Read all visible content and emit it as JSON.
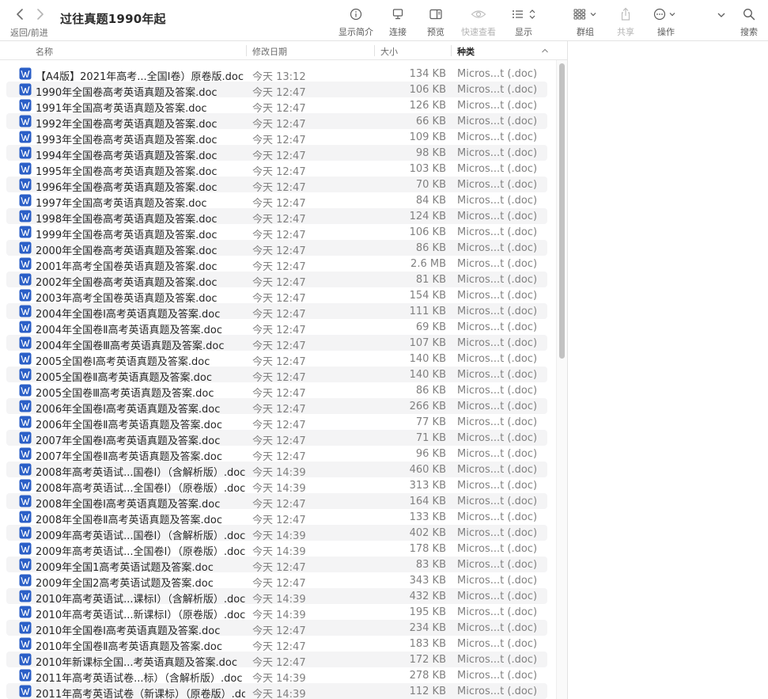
{
  "window": {
    "title": "过往真题1990年起",
    "nav_label": "返回/前进"
  },
  "toolbar": {
    "buttons": [
      {
        "label": "显示简介",
        "icon": "info-icon",
        "enabled": true
      },
      {
        "label": "连接",
        "icon": "monitor-icon",
        "enabled": true
      },
      {
        "label": "预览",
        "icon": "preview-pane-icon",
        "enabled": true
      },
      {
        "label": "快速查看",
        "icon": "eye-icon",
        "enabled": false
      },
      {
        "label": "显示",
        "icon": "list-view-icon",
        "enabled": true
      },
      {
        "label": "群组",
        "icon": "group-grid-icon",
        "enabled": true
      },
      {
        "label": "共享",
        "icon": "share-icon",
        "enabled": false
      },
      {
        "label": "操作",
        "icon": "ellipsis-circle-icon",
        "enabled": true
      },
      {
        "label": "搜索",
        "icon": "search-icon",
        "enabled": true
      }
    ]
  },
  "columns": {
    "name": "名称",
    "date": "修改日期",
    "size": "大小",
    "kind": "种类"
  },
  "files": [
    {
      "name": "【A4版】2021年高考...全国Ⅰ卷）原卷版.doc",
      "date": "今天 13:12",
      "size": "134 KB",
      "kind": "Micros...t (.doc)"
    },
    {
      "name": "1990年全国卷高考英语真题及答案.doc",
      "date": "今天 12:47",
      "size": "106 KB",
      "kind": "Micros...t (.doc)"
    },
    {
      "name": "1991年全国高考英语真题及答案.doc",
      "date": "今天 12:47",
      "size": "126 KB",
      "kind": "Micros...t (.doc)"
    },
    {
      "name": "1992年全国卷高考英语真题及答案.doc",
      "date": "今天 12:47",
      "size": "66 KB",
      "kind": "Micros...t (.doc)"
    },
    {
      "name": "1993年全国卷高考英语真题及答案.doc",
      "date": "今天 12:47",
      "size": "109 KB",
      "kind": "Micros...t (.doc)"
    },
    {
      "name": "1994年全国卷高考英语真题及答案.doc",
      "date": "今天 12:47",
      "size": "98 KB",
      "kind": "Micros...t (.doc)"
    },
    {
      "name": "1995年全国卷高考英语真题及答案.doc",
      "date": "今天 12:47",
      "size": "103 KB",
      "kind": "Micros...t (.doc)"
    },
    {
      "name": "1996年全国卷高考英语真题及答案.doc",
      "date": "今天 12:47",
      "size": "70 KB",
      "kind": "Micros...t (.doc)"
    },
    {
      "name": "1997年全国高考英语真题及答案.doc",
      "date": "今天 12:47",
      "size": "84 KB",
      "kind": "Micros...t (.doc)"
    },
    {
      "name": "1998年全国卷高考英语真题及答案.doc",
      "date": "今天 12:47",
      "size": "124 KB",
      "kind": "Micros...t (.doc)"
    },
    {
      "name": "1999年全国卷高考英语真题及答案.doc",
      "date": "今天 12:47",
      "size": "106 KB",
      "kind": "Micros...t (.doc)"
    },
    {
      "name": "2000年全国卷高考英语真题及答案.doc",
      "date": "今天 12:47",
      "size": "86 KB",
      "kind": "Micros...t (.doc)"
    },
    {
      "name": "2001年高考全国卷英语真题及答案.doc",
      "date": "今天 12:47",
      "size": "2.6 MB",
      "kind": "Micros...t (.doc)"
    },
    {
      "name": "2002年全国卷高考英语真题及答案.doc",
      "date": "今天 12:47",
      "size": "81 KB",
      "kind": "Micros...t (.doc)"
    },
    {
      "name": "2003年高考全国卷英语真题及答案.doc",
      "date": "今天 12:47",
      "size": "154 KB",
      "kind": "Micros...t (.doc)"
    },
    {
      "name": "2004年全国卷Ⅰ高考英语真题及答案.doc",
      "date": "今天 12:47",
      "size": "111 KB",
      "kind": "Micros...t (.doc)"
    },
    {
      "name": "2004年全国卷Ⅱ高考英语真题及答案.doc",
      "date": "今天 12:47",
      "size": "69 KB",
      "kind": "Micros...t (.doc)"
    },
    {
      "name": "2004年全国卷Ⅲ高考英语真题及答案.doc",
      "date": "今天 12:47",
      "size": "107 KB",
      "kind": "Micros...t (.doc)"
    },
    {
      "name": "2005全国卷Ⅰ高考英语真题及答案.doc",
      "date": "今天 12:47",
      "size": "140 KB",
      "kind": "Micros...t (.doc)"
    },
    {
      "name": "2005全国卷Ⅱ高考英语真题及答案.doc",
      "date": "今天 12:47",
      "size": "140 KB",
      "kind": "Micros...t (.doc)"
    },
    {
      "name": "2005全国卷Ⅲ高考英语真题及答案.doc",
      "date": "今天 12:47",
      "size": "86 KB",
      "kind": "Micros...t (.doc)"
    },
    {
      "name": "2006年全国卷Ⅰ高考英语真题及答案.doc",
      "date": "今天 12:47",
      "size": "266 KB",
      "kind": "Micros...t (.doc)"
    },
    {
      "name": "2006年全国卷Ⅱ高考英语真题及答案.doc",
      "date": "今天 12:47",
      "size": "77 KB",
      "kind": "Micros...t (.doc)"
    },
    {
      "name": "2007年全国卷Ⅰ高考英语真题及答案.doc",
      "date": "今天 12:47",
      "size": "71 KB",
      "kind": "Micros...t (.doc)"
    },
    {
      "name": "2007年全国卷Ⅱ高考英语真题及答案.doc",
      "date": "今天 12:47",
      "size": "96 KB",
      "kind": "Micros...t (.doc)"
    },
    {
      "name": "2008年高考英语试...国卷Ⅰ）（含解析版）.doc",
      "date": "今天 14:39",
      "size": "460 KB",
      "kind": "Micros...t (.doc)"
    },
    {
      "name": "2008年高考英语试...全国卷Ⅰ）（原卷版）.doc",
      "date": "今天 14:39",
      "size": "313 KB",
      "kind": "Micros...t (.doc)"
    },
    {
      "name": "2008年全国卷Ⅰ高考英语真题及答案.doc",
      "date": "今天 12:47",
      "size": "164 KB",
      "kind": "Micros...t (.doc)"
    },
    {
      "name": "2008年全国卷Ⅱ高考英语真题及答案.doc",
      "date": "今天 12:47",
      "size": "133 KB",
      "kind": "Micros...t (.doc)"
    },
    {
      "name": "2009年高考英语试...国卷Ⅰ）（含解析版）.doc",
      "date": "今天 14:39",
      "size": "402 KB",
      "kind": "Micros...t (.doc)"
    },
    {
      "name": "2009年高考英语试...全国卷Ⅰ）（原卷版）.doc",
      "date": "今天 14:39",
      "size": "178 KB",
      "kind": "Micros...t (.doc)"
    },
    {
      "name": "2009年全国1高考英语试题及答案.doc",
      "date": "今天 12:47",
      "size": "83 KB",
      "kind": "Micros...t (.doc)"
    },
    {
      "name": "2009年全国2高考英语试题及答案.doc",
      "date": "今天 12:47",
      "size": "343 KB",
      "kind": "Micros...t (.doc)"
    },
    {
      "name": "2010年高考英语试...课标Ⅰ）（含解析版）.doc",
      "date": "今天 14:39",
      "size": "432 KB",
      "kind": "Micros...t (.doc)"
    },
    {
      "name": "2010年高考英语试...新课标Ⅰ）（原卷版）.doc",
      "date": "今天 14:39",
      "size": "195 KB",
      "kind": "Micros...t (.doc)"
    },
    {
      "name": "2010年全国卷Ⅰ高考英语真题及答案.doc",
      "date": "今天 12:47",
      "size": "234 KB",
      "kind": "Micros...t (.doc)"
    },
    {
      "name": "2010年全国卷Ⅱ高考英语真题及答案.doc",
      "date": "今天 12:47",
      "size": "183 KB",
      "kind": "Micros...t (.doc)"
    },
    {
      "name": "2010年新课标全国...考英语真题及答案.doc",
      "date": "今天 12:47",
      "size": "172 KB",
      "kind": "Micros...t (.doc)"
    },
    {
      "name": "2011年高考英语试卷...标）（含解析版）.doc",
      "date": "今天 14:39",
      "size": "278 KB",
      "kind": "Micros...t (.doc)"
    },
    {
      "name": "2011年高考英语试卷（新课标）（原卷版）.doc",
      "date": "今天 14:39",
      "size": "112 KB",
      "kind": "Micros...t (.doc)"
    }
  ],
  "colors": {
    "word_icon": "#2b5fc7",
    "alt_row": "#f4f4f5",
    "scroll_thumb": "#c2c2c2"
  }
}
